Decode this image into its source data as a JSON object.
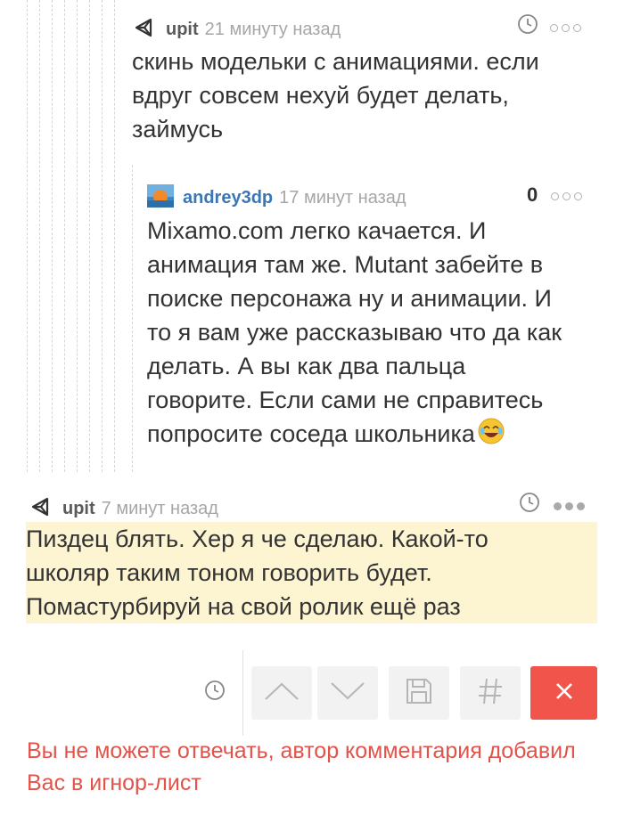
{
  "comments": [
    {
      "author": "upit",
      "time": "21 минуту назад",
      "lines": [
        "скинь модельки с анимациями. если",
        "вдруг совсем нехуй будет делать,",
        "займусь"
      ]
    },
    {
      "author": "andrey3dp",
      "time": "17 минут назад",
      "rating": "0",
      "lines": [
        "Mixamo.com легко качается. И",
        "анимация там же. Mutant забейте в",
        "поиске персонажа ну и анимации. И",
        "то я вам уже рассказываю что да как",
        "делать. А вы как два пальца",
        "говорите. Если сами не справитесь",
        "попросите соседа школьника"
      ]
    },
    {
      "author": "upit",
      "time": "7 минут назад",
      "lines": [
        "Пиздец блять. Хер я че сделаю. Какой-то",
        "школяр таким тоном говорить будет.",
        "Помастурбируй на свой ролик ещё раз"
      ]
    }
  ],
  "toolbar": {
    "icons": [
      "clock-icon",
      "up-arrow-icon",
      "down-arrow-icon",
      "save-icon",
      "hash-icon",
      "close-icon"
    ]
  },
  "notice": "Вы не можете отвечать, автор комментария добавил Вас в игнор-лист",
  "colors": {
    "link_blue": "#3b77b4",
    "highlight": "#fdf4d1",
    "close_button": "#f0544a",
    "notice_text": "#e2534a"
  }
}
